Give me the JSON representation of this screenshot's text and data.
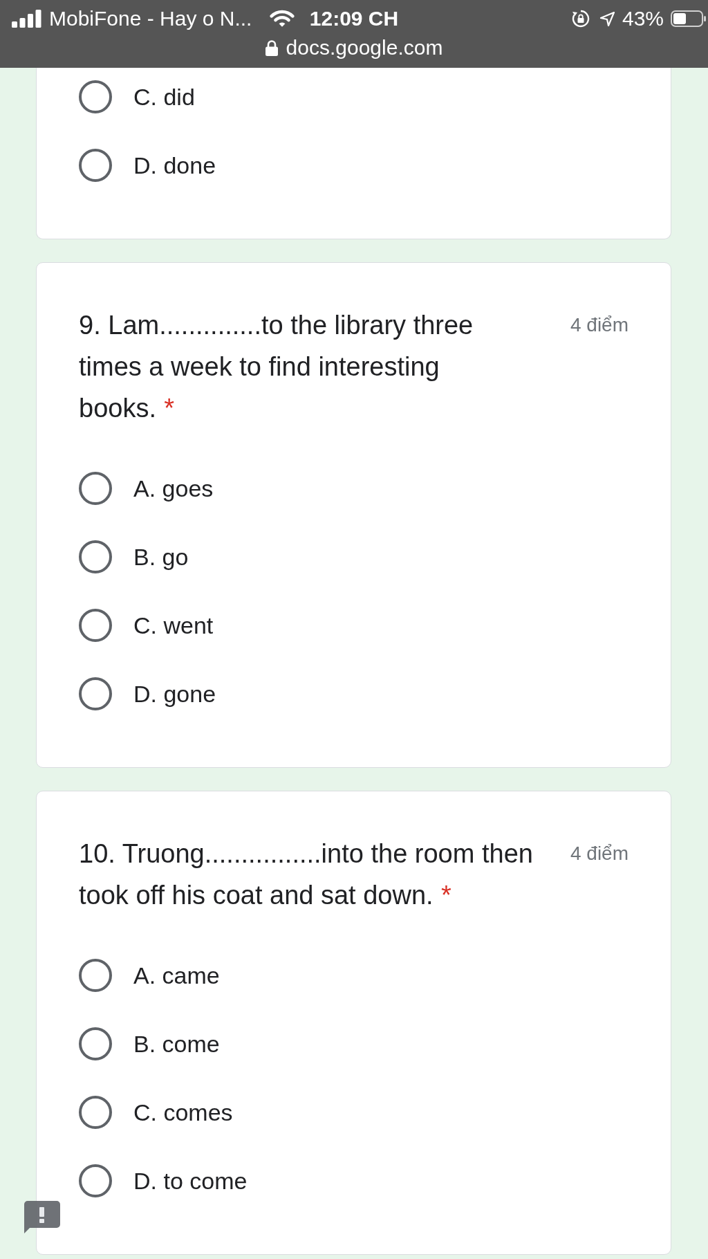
{
  "status_bar": {
    "carrier": "MobiFone - Hay o N...",
    "time": "12:09 CH",
    "battery": "43%",
    "url": "docs.google.com"
  },
  "questions": [
    {
      "options": [
        {
          "label": "C. did",
          "selected": false
        },
        {
          "label": "D. done",
          "selected": false
        }
      ]
    },
    {
      "title": "9. Lam..............to the library three times a week to find interesting books.",
      "required_mark": "*",
      "points": "4 điểm",
      "options": [
        {
          "label": "A. goes",
          "selected": false
        },
        {
          "label": "B. go",
          "selected": false
        },
        {
          "label": "C. went",
          "selected": false
        },
        {
          "label": "D. gone",
          "selected": false
        }
      ]
    },
    {
      "title": "10. Truong................into the room then took off his coat and sat down.",
      "required_mark": "*",
      "points": "4 điểm",
      "options": [
        {
          "label": "A. came",
          "selected": false
        },
        {
          "label": "B. come",
          "selected": false
        },
        {
          "label": "C. comes",
          "selected": false
        },
        {
          "label": "D. to come",
          "selected": false
        }
      ]
    }
  ]
}
